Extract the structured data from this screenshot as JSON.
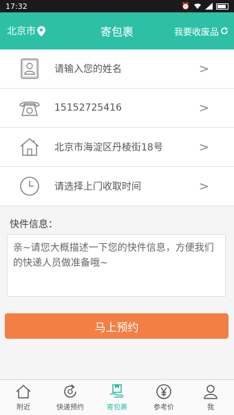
{
  "status_bar": {
    "time": "17:32"
  },
  "header": {
    "city": "北京市",
    "title": "寄包裹",
    "right_action": "我要收废品"
  },
  "form": {
    "name_placeholder": "请输入您的姓名",
    "phone_value": "15152725416",
    "address_value": "北京市海淀区丹棱街18号",
    "time_placeholder": "请选择上门收取时间"
  },
  "note": {
    "label": "快件信息：",
    "placeholder": "亲~请您大概描述一下您的快件信息，方便我们的快递人员做准备哦~"
  },
  "submit_label": "马上预约",
  "tabs": [
    {
      "label": "附近",
      "icon": "home-icon"
    },
    {
      "label": "快递预约",
      "icon": "refresh-icon"
    },
    {
      "label": "寄包裹",
      "icon": "package-icon"
    },
    {
      "label": "参考价",
      "icon": "yen-icon"
    },
    {
      "label": "我",
      "icon": "user-icon"
    }
  ],
  "colors": {
    "primary": "#2dc0a6",
    "accent": "#f37f44"
  }
}
